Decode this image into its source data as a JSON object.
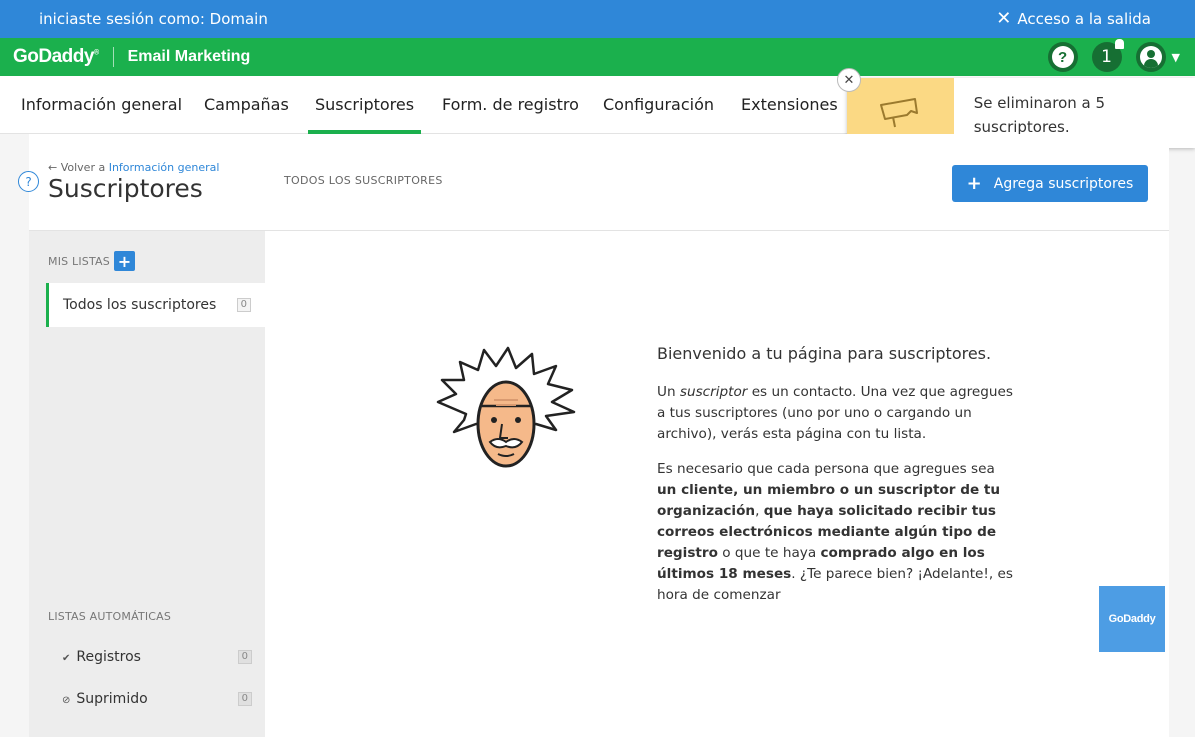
{
  "impersonation": {
    "text": "iniciaste sesión como: Domain",
    "exit_label": "Acceso a la salida"
  },
  "brand": {
    "logo": "GoDaddy",
    "product": "Email Marketing",
    "notification_count": "1"
  },
  "nav": {
    "items": [
      {
        "label": "Información general"
      },
      {
        "label": "Campañas"
      },
      {
        "label": "Suscriptores"
      },
      {
        "label": "Form. de registro"
      },
      {
        "label": "Configuración"
      },
      {
        "label": "Extensiones"
      }
    ]
  },
  "toast": {
    "message": "Se eliminaron a 5 suscriptores."
  },
  "header": {
    "back_prefix": "← Volver a ",
    "back_link": "Información general",
    "title": "Suscriptores",
    "filter_label": "TODOS LOS SUSCRIPTORES",
    "add_button": "Agrega suscriptores"
  },
  "sidebar": {
    "my_lists_heading": "MIS LISTAS",
    "lists": [
      {
        "label": "Todos los suscriptores",
        "count": "0"
      }
    ],
    "auto_heading": "LISTAS AUTOMÁTICAS",
    "auto_lists": [
      {
        "label": "Registros",
        "count": "0"
      },
      {
        "label": "Suprimido",
        "count": "0"
      }
    ]
  },
  "welcome": {
    "title": "Bienvenido a tu página para suscriptores.",
    "p1_pre": "Un ",
    "p1_em": "suscriptor",
    "p1_post": " es un contacto. Una vez que agregues a tus suscriptores (uno por uno o cargando un archivo), verás esta página con tu lista.",
    "p2_a": "Es necesario que cada persona que agregues sea ",
    "p2_b": "un cliente, un miembro o un suscriptor de tu organización",
    "p2_c": ", ",
    "p2_d": "que haya solicitado recibir tus correos electrónicos mediante algún tipo de registro",
    "p2_e": " o que te haya ",
    "p2_f": "comprado algo en los últimos 18 meses",
    "p2_g": ". ¿Te parece bien? ¡Adelante!, es hora de comenzar"
  },
  "badge": {
    "label": "GoDaddy"
  },
  "colors": {
    "blue": "#2f87d8",
    "green": "#1bb04d",
    "toast_yellow": "#fbd984"
  }
}
